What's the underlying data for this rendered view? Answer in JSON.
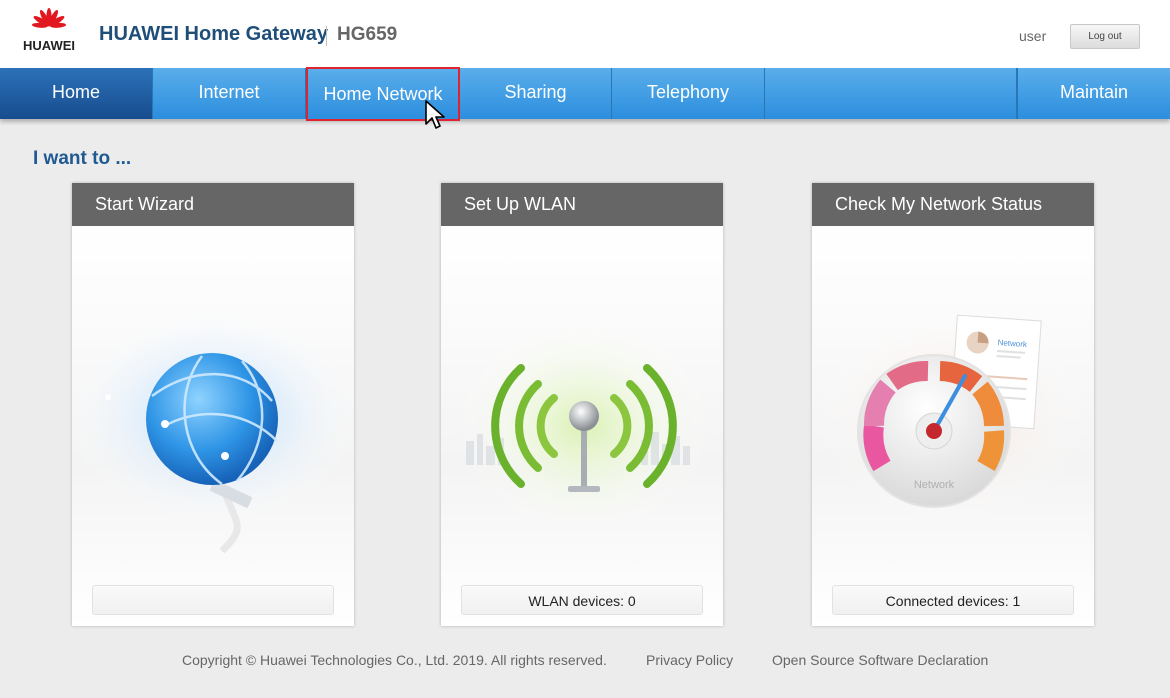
{
  "header": {
    "brand": "HUAWEI",
    "app_title": "HUAWEI Home Gateway",
    "model": "HG659",
    "username": "user",
    "logout_label": "Log out"
  },
  "nav": {
    "items": [
      {
        "label": "Home",
        "active": true
      },
      {
        "label": "Internet"
      },
      {
        "label": "Home Network",
        "highlighted": true
      },
      {
        "label": "Sharing"
      },
      {
        "label": "Telephony"
      },
      {
        "label": "Maintain"
      }
    ]
  },
  "main": {
    "section_title": "I want to ...",
    "cards": [
      {
        "title": "Start Wizard",
        "footer": "",
        "icon": "globe-icon"
      },
      {
        "title": "Set Up WLAN",
        "footer": "WLAN devices: 0",
        "icon": "wifi-antenna-icon"
      },
      {
        "title": "Check My Network Status",
        "footer": "Connected devices: 1",
        "icon": "speedometer-icon",
        "gauge_label": "Network",
        "doc_label": "Network"
      }
    ]
  },
  "footer": {
    "copyright": "Copyright © Huawei Technologies Co., Ltd. 2019. All rights reserved.",
    "privacy": "Privacy Policy",
    "open_source": "Open Source Software Declaration"
  },
  "colors": {
    "nav_blue": "#2c8ede",
    "nav_active": "#174d8e",
    "title_blue": "#1f4e79",
    "card_header": "#666666",
    "highlight_red": "#e0242f",
    "brand_red": "#e1181f"
  }
}
